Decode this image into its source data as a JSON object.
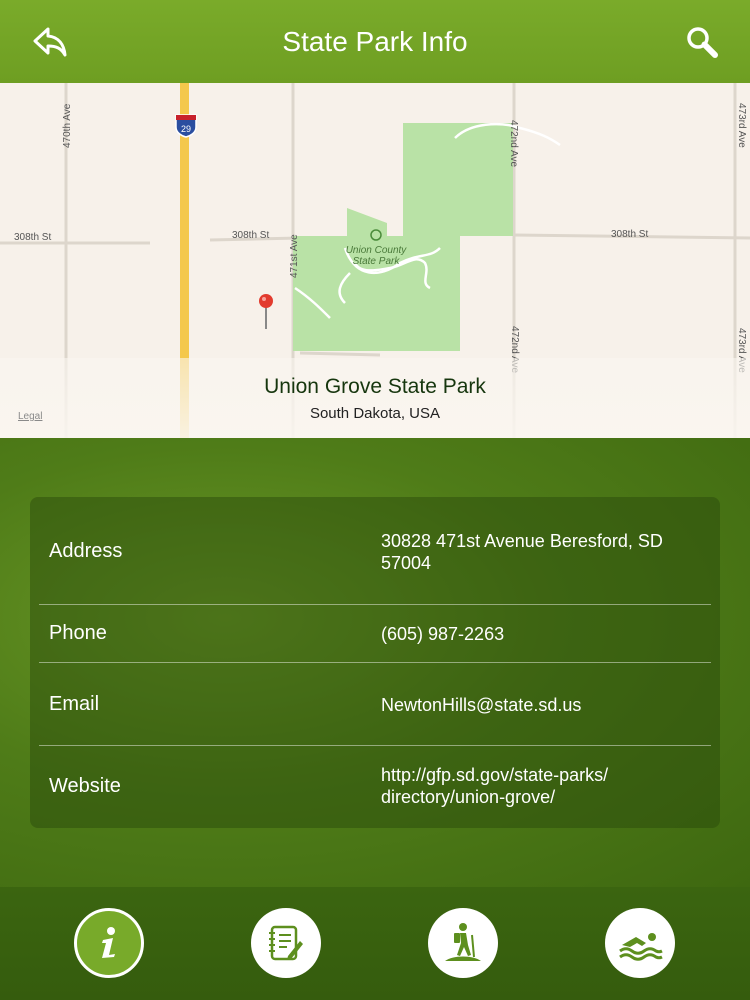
{
  "header": {
    "title": "State Park Info",
    "back_icon": "back-arrow-icon",
    "search_icon": "search-icon"
  },
  "map": {
    "park_name": "Union Grove State Park",
    "location": "South Dakota, USA",
    "legal": "Legal",
    "park_map_label_line1": "Union County",
    "park_map_label_line2": "State Park",
    "streets": {
      "s308_left": "308th St",
      "s308_mid": "308th St",
      "s308_right": "308th St",
      "ave470": "470th Ave",
      "ave471": "471st Ave",
      "ave472_top": "472nd Ave",
      "ave472_bottom": "472nd Ave",
      "ave473_top": "473rd Ave",
      "ave473_bottom": "473rd Ave",
      "interstate": "29"
    }
  },
  "info": {
    "address_label": "Address",
    "address_value_line1": "30828 471st Avenue Beresford, SD",
    "address_value_line2": "57004",
    "phone_label": "Phone",
    "phone_value": "(605) 987-2263",
    "email_label": "Email",
    "email_value": "NewtonHills@state.sd.us",
    "website_label": "Website",
    "website_value_line1": "http://gfp.sd.gov/state-parks/",
    "website_value_line2": "directory/union-grove/"
  },
  "tabs": [
    {
      "icon": "info-icon",
      "active": true
    },
    {
      "icon": "notes-icon",
      "active": false
    },
    {
      "icon": "hiker-icon",
      "active": false
    },
    {
      "icon": "swimmer-icon",
      "active": false
    }
  ],
  "colors": {
    "header": "#6e9e22",
    "park_green": "#b9e2a6",
    "highway": "#f4c84c",
    "pin": "#e23b2e",
    "tab_active": "#78aa2a"
  }
}
